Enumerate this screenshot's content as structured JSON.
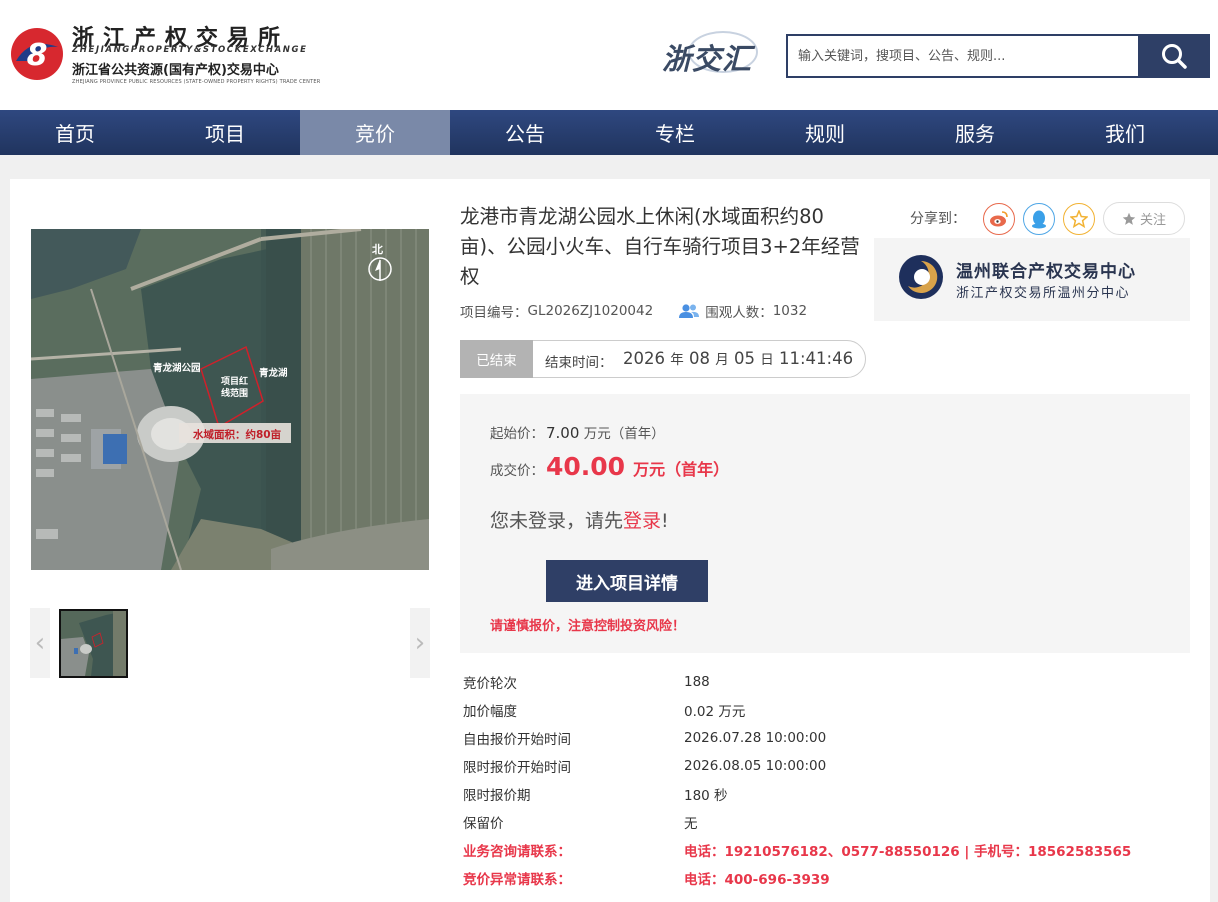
{
  "header": {
    "logo_title": "浙江产权交易所",
    "logo_en": "ZHEJIANGPROPERTY&STOCKEXCHANGE",
    "logo_sub": "浙江省公共资源(国有产权)交易中心",
    "logo_sub_en": "ZHEJIANG PROVINCE PUBLIC RESOURCES (STATE-OWNED PROPERTY RIGHTS) TRADE CENTER",
    "brand": "浙交汇",
    "search_placeholder": "输入关键词，搜项目、公告、规则..."
  },
  "nav": {
    "items": [
      "首页",
      "项目",
      "竞价",
      "公告",
      "专栏",
      "规则",
      "服务",
      "我们"
    ],
    "active_index": 2
  },
  "map": {
    "north": "北",
    "label_park": "青龙湖公园",
    "label_lake": "青龙湖",
    "label_boundary_1": "项目红",
    "label_boundary_2": "线范围",
    "label_area": "水域面积：约80亩"
  },
  "project": {
    "title": "龙港市青龙湖公园水上休闲(水域面积约80亩)、公园小火车、自行车骑行项目3+2年经营权",
    "code_label": "项目编号：",
    "code": "GL2026ZJ1020042",
    "views_label": "围观人数：",
    "views": "1032",
    "share_label": "分享到：",
    "follow_label": "关注"
  },
  "org": {
    "name": "温州联合产权交易中心",
    "sub": "浙江产权交易所温州分中心"
  },
  "status": {
    "tag": "已结束",
    "end_label": "结束时间：",
    "year": "2026",
    "year_unit": "年",
    "month": "08",
    "month_unit": "月",
    "day": "05",
    "day_unit": "日",
    "time": "11:41:46"
  },
  "price": {
    "start_label": "起始价：",
    "start_value": "7.00",
    "start_unit": "万元（首年）",
    "deal_label": "成交价：",
    "deal_value": "40.00",
    "deal_unit": "万元（首年）",
    "login_prefix": "您未登录，请先",
    "login_link": "登录",
    "login_suffix": "!",
    "enter_button": "进入项目详情",
    "warning": "请谨慎报价，注意控制投资风险！"
  },
  "info": [
    {
      "key": "竞价轮次",
      "value": "188"
    },
    {
      "key": "加价幅度",
      "value": "0.02 万元"
    },
    {
      "key": "自由报价开始时间",
      "value": "2026.07.28 10:00:00"
    },
    {
      "key": "限时报价开始时间",
      "value": "2026.08.05 10:00:00"
    },
    {
      "key": "限时报价期",
      "value": "180 秒"
    },
    {
      "key": "保留价",
      "value": "无"
    },
    {
      "key": "业务咨询请联系：",
      "value": "电话：19210576182、0577-88550126 | 手机号：18562583565"
    },
    {
      "key": "竞价异常请联系：",
      "value": "电话：400-696-3939"
    }
  ],
  "colors": {
    "navy": "#2e3f66",
    "accent_red": "#e8374a",
    "nav_active": "#7a89a8",
    "status_gray": "#b3b3b3"
  },
  "icons": {
    "search": "magnifier-icon",
    "views": "users-icon",
    "weibo": "weibo-icon",
    "qq": "qq-penguin-icon",
    "qzone": "qzone-star-icon",
    "follow": "star-icon"
  }
}
